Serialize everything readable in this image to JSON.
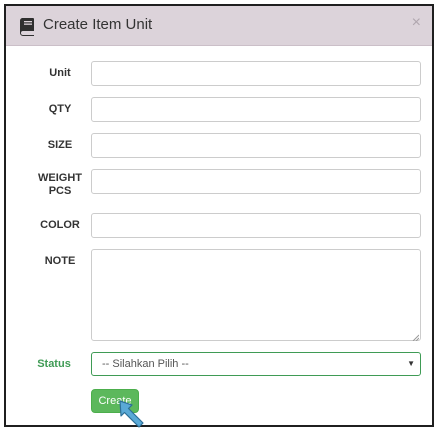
{
  "dialog": {
    "title": "Create Item Unit",
    "close_label": "×"
  },
  "form": {
    "unit_label": "Unit",
    "qty_label": "QTY",
    "size_label": "SIZE",
    "weight_label_line1": "WEIGHT",
    "weight_label_line2": "PCS",
    "color_label": "COLOR",
    "note_label": "NOTE",
    "status_label": "Status",
    "status_selected": "-- Silahkan Pilih --",
    "create_label": "Create"
  },
  "colors": {
    "header_bg": "#dcd3da",
    "accent_green": "#3f9b55",
    "button_green": "#5cb85c",
    "pointer_blue": "#5aa9d6"
  },
  "icons": {
    "title": "book-icon",
    "close": "close-icon",
    "select": "caret-down-icon",
    "pointer": "arrow-pointer-icon"
  }
}
